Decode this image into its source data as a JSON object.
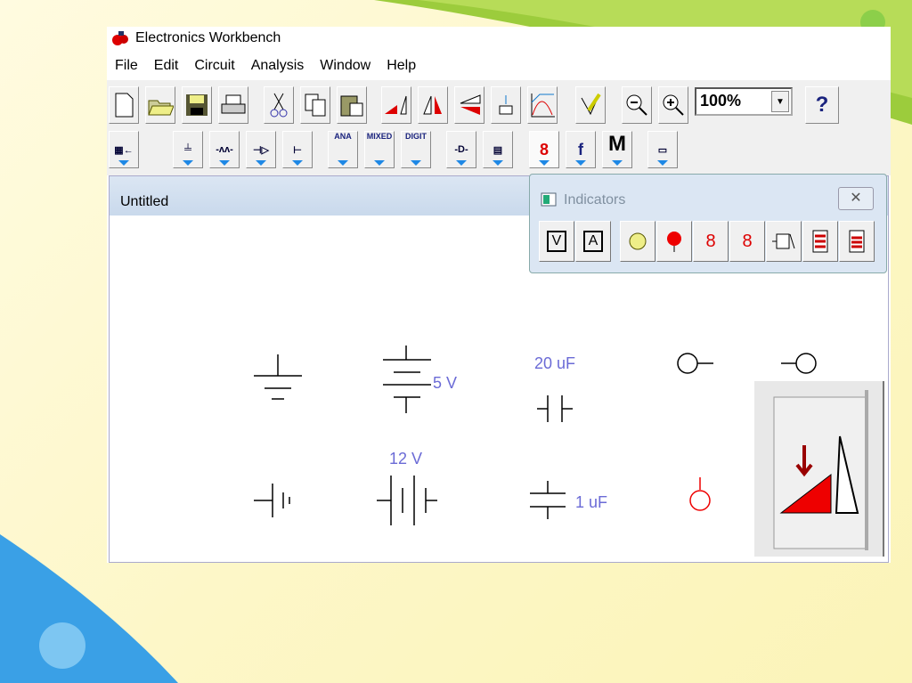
{
  "window": {
    "title": "Electronics Workbench"
  },
  "menu": [
    "File",
    "Edit",
    "Circuit",
    "Analysis",
    "Window",
    "Help"
  ],
  "toolbar": {
    "zoom_value": "100%",
    "help_label": "?"
  },
  "parts_bin": {
    "ana": "ANA",
    "mixed": "MIXED",
    "digit": "DIGIT",
    "misc": "M",
    "func": "f"
  },
  "document": {
    "title": "Untitled"
  },
  "indicators": {
    "title": "Indicators",
    "close": "✕",
    "voltmeter": "V",
    "ammeter": "A"
  },
  "canvas": {
    "label_5v": "5 V",
    "label_20uf": "20 uF",
    "label_12v": "12 V",
    "label_1uf": "1 uF"
  }
}
